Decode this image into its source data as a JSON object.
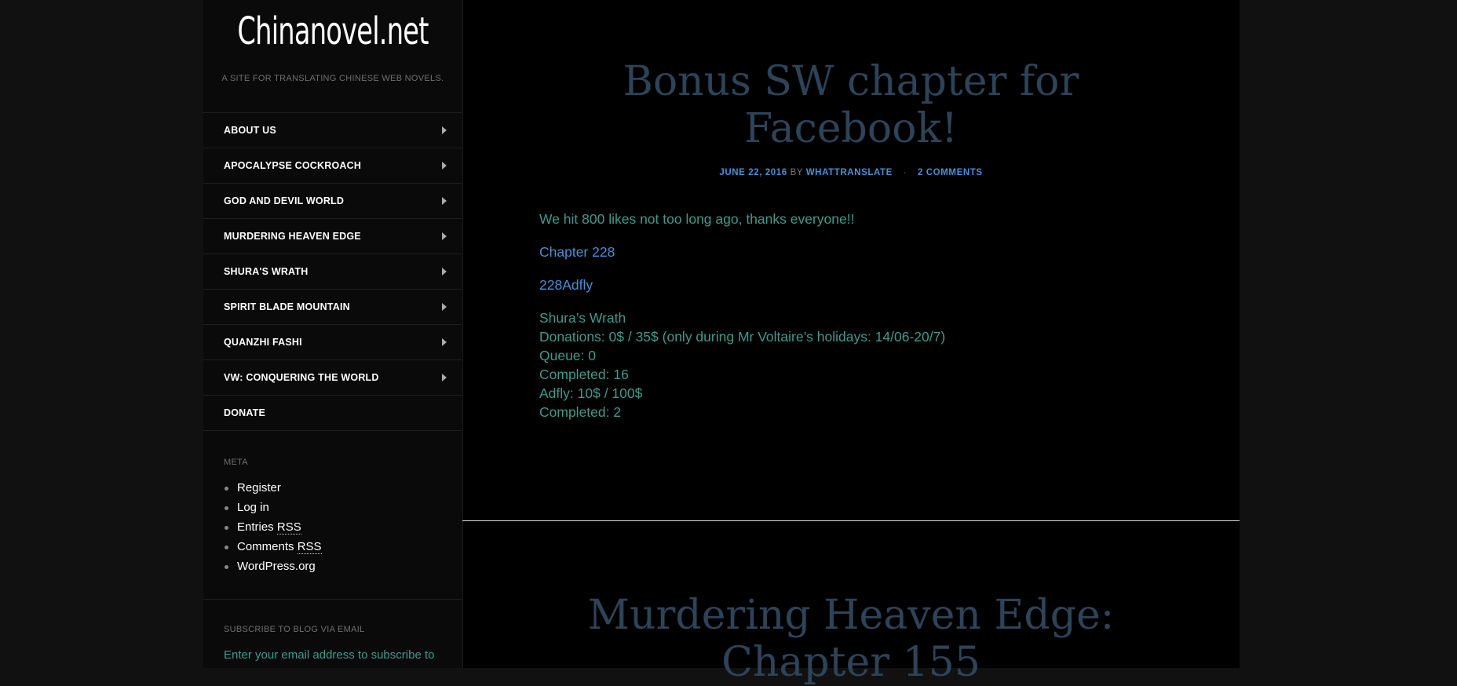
{
  "site": {
    "title": "Chinanovel.net",
    "description": "A SITE FOR TRANSLATING CHINESE WEB NOVELS."
  },
  "menu": {
    "items": [
      {
        "label": "ABOUT US",
        "has_children": true
      },
      {
        "label": "APOCALYPSE COCKROACH",
        "has_children": true
      },
      {
        "label": "GOD AND DEVIL WORLD",
        "has_children": true
      },
      {
        "label": "MURDERING HEAVEN EDGE",
        "has_children": true
      },
      {
        "label": "SHURA'S WRATH",
        "has_children": true
      },
      {
        "label": "SPIRIT BLADE MOUNTAIN",
        "has_children": true
      },
      {
        "label": "QUANZHI FASHI",
        "has_children": true
      },
      {
        "label": "VW: CONQUERING THE WORLD",
        "has_children": true
      },
      {
        "label": "DONATE",
        "has_children": false
      }
    ]
  },
  "meta_widget": {
    "title": "META",
    "links": [
      "Register",
      "Log in",
      "Entries",
      "Comments",
      "WordPress.org"
    ],
    "rss_label": "RSS"
  },
  "subscribe_widget": {
    "title": "SUBSCRIBE TO BLOG VIA EMAIL",
    "text": "Enter your email address to subscribe to"
  },
  "posts": [
    {
      "title_line1": "Bonus SW chapter for",
      "title_line2": "Facebook!",
      "date": "JUNE 22, 2016",
      "by": "BY",
      "author": "WHATTRANSLATE",
      "separator": "·",
      "comments": "2 COMMENTS",
      "intro": "We hit 800 likes not too long ago, thanks everyone!!",
      "link1": "Chapter 228",
      "link2": "228Adfly",
      "stats": [
        "Shura’s Wrath",
        "Donations: 0$ / 35$ (only during Mr Voltaire’s holidays: 14/06-20/7)",
        "Queue: 0",
        "Completed: 16",
        "Adfly: 10$ / 100$",
        "Completed: 2"
      ]
    },
    {
      "title_line1": "Murdering Heaven Edge:",
      "title_line2": "Chapter 155"
    }
  ],
  "colors": {
    "title": "#2d4358",
    "link": "#4a8fd6",
    "body_text": "#3f9a8c",
    "page_bg": "#000000",
    "outer_bg": "#111111"
  }
}
